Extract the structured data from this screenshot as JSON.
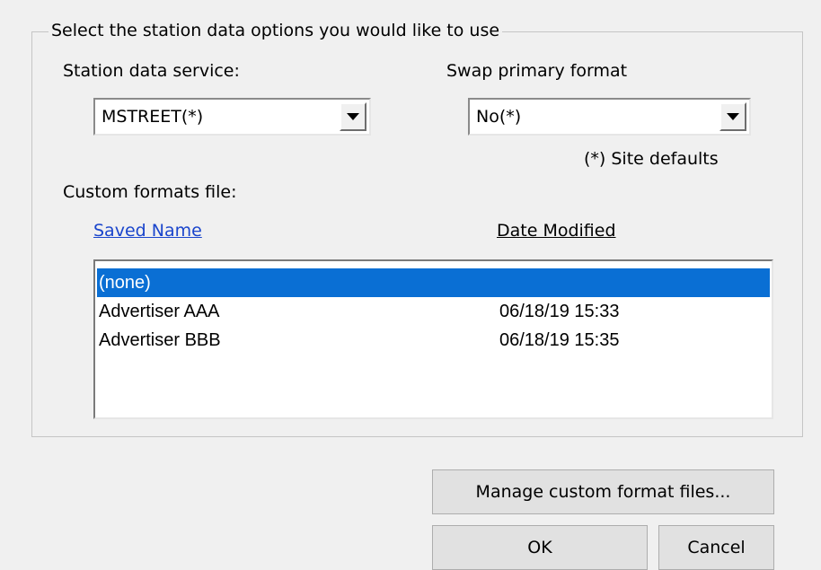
{
  "group": {
    "title": "Select the station data options you would like to use"
  },
  "station_service": {
    "label": "Station data service:",
    "selected": "MSTREET(*)"
  },
  "swap_format": {
    "label": "Swap primary format",
    "selected": "No(*)"
  },
  "site_defaults_note": "(*) Site defaults",
  "custom_formats": {
    "label": "Custom formats file:",
    "columns": {
      "saved_name": "Saved Name",
      "date_modified": "Date Modified"
    },
    "rows": [
      {
        "name": "(none)",
        "date": "",
        "selected": true
      },
      {
        "name": "Advertiser AAA",
        "date": "06/18/19 15:33",
        "selected": false
      },
      {
        "name": "Advertiser BBB",
        "date": "06/18/19 15:35",
        "selected": false
      }
    ]
  },
  "buttons": {
    "manage": "Manage custom format files...",
    "ok": "OK",
    "cancel": "Cancel"
  },
  "colors": {
    "dialog_bg": "#f0f0f0",
    "selection": "#0a6fd4",
    "link": "#1a45cc"
  }
}
